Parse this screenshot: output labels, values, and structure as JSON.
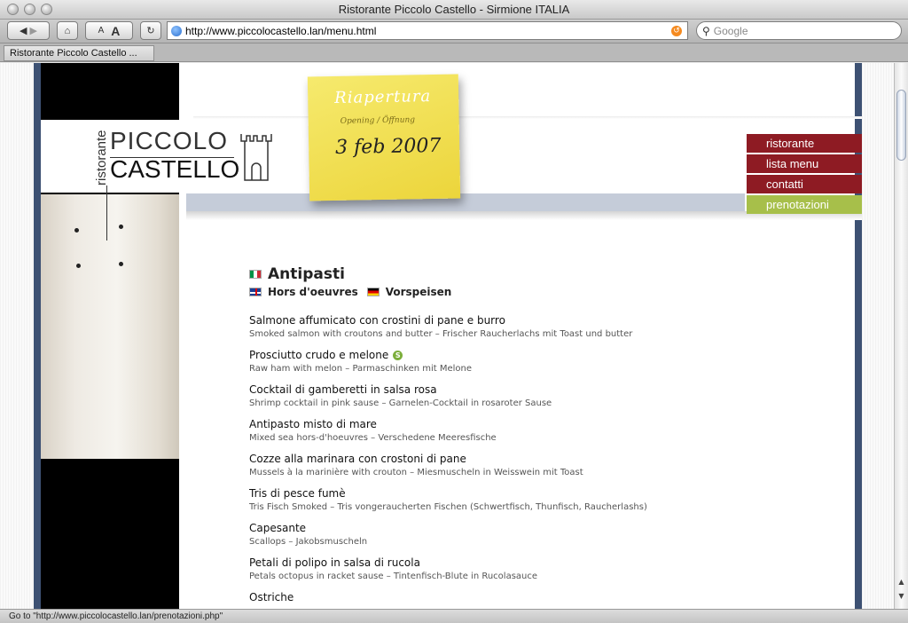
{
  "window": {
    "title": "Ristorante Piccolo Castello - Sirmione ITALIA"
  },
  "toolbar": {
    "url": "http://www.piccolocastello.lan/menu.html",
    "search_placeholder": "Google",
    "text_smaller": "A",
    "text_bigger": "A"
  },
  "tab": {
    "title": "Ristorante Piccolo Castello ..."
  },
  "logo": {
    "ristorante": "ristorante",
    "line1": "PICCOLO",
    "line2": "CASTELLO"
  },
  "postit": {
    "title": "Riapertura",
    "subtitle": "Opening / Öffnung",
    "date": "3 feb 2007"
  },
  "nav": [
    {
      "label": "ristorante"
    },
    {
      "label": "lista menu"
    },
    {
      "label": "contatti"
    },
    {
      "label": "prenotazioni"
    }
  ],
  "menu": {
    "title": "Antipasti",
    "title_en": "Hors d'oeuvres",
    "title_de": "Vorspeisen",
    "dishes": [
      {
        "name": "Salmone affumicato con crostini di pane e burro",
        "desc": "Smoked salmon with croutons and butter – Frischer Raucherlachs mit Toast und butter"
      },
      {
        "name": "Prosciutto crudo e melone",
        "desc": "Raw ham with melon – Parmaschinken mit Melone"
      },
      {
        "name": "Cocktail di gamberetti in salsa rosa",
        "desc": "Shrimp cocktail in pink sause – Garnelen-Cocktail in rosaroter Sause"
      },
      {
        "name": "Antipasto misto di mare",
        "desc": "Mixed sea hors-d'hoeuvres – Verschedene Meeresfische"
      },
      {
        "name": "Cozze alla marinara con crostoni di pane",
        "desc": "Mussels à la marinière with crouton – Miesmuscheln in Weisswein mit Toast"
      },
      {
        "name": "Tris di pesce fumè",
        "desc": "Tris Fisch Smoked – Tris vongeraucherten Fischen (Schwertfisch, Thunfisch, Raucherlashs)"
      },
      {
        "name": "Capesante",
        "desc": "Scallops – Jakobsmuscheln"
      },
      {
        "name": "Petali di polipo in salsa di rucola",
        "desc": "Petals octopus in racket sause – Tintenfisch-Blute in Rucolasauce"
      },
      {
        "name": "Ostriche",
        "desc": ""
      }
    ]
  },
  "statusbar": {
    "text": "Go to \"http://www.piccolocastello.lan/prenotazioni.php\""
  },
  "colors": {
    "nav_red": "#8e1b23",
    "nav_green": "#a7bf4a",
    "postit_yellow": "#f0de4f",
    "site_border": "#3d5173"
  }
}
